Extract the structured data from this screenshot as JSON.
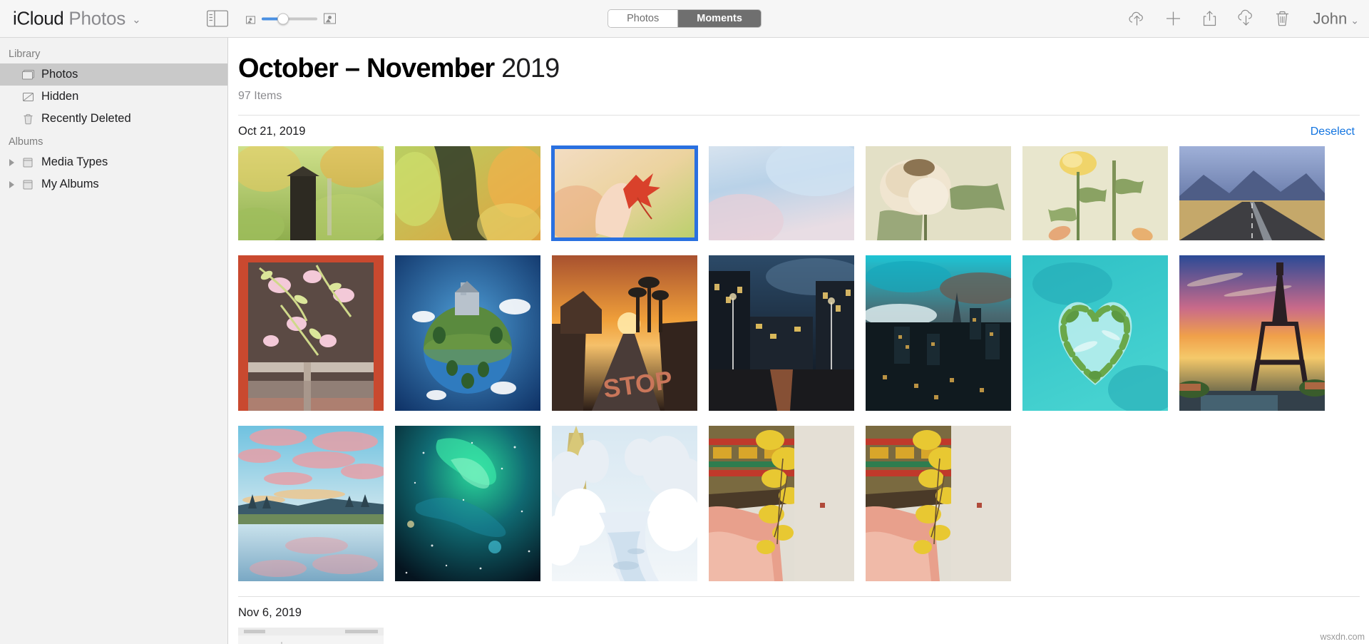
{
  "toolbar": {
    "brand_primary": "iCloud",
    "brand_secondary": "Photos",
    "brand_caret": "⌄",
    "sidebar_toggle_name": "sidebar-toggle",
    "zoom_small_label": "small-thumbnail-icon",
    "zoom_large_label": "large-thumbnail-icon",
    "segments": [
      {
        "label": "Photos",
        "active": false
      },
      {
        "label": "Moments",
        "active": true
      }
    ],
    "actions": [
      {
        "name": "upload-icon",
        "title": "Upload"
      },
      {
        "name": "plus-icon",
        "title": "New Album"
      },
      {
        "name": "share-icon",
        "title": "Share"
      },
      {
        "name": "download-icon",
        "title": "Download"
      },
      {
        "name": "trash-icon",
        "title": "Delete"
      }
    ],
    "account_name": "John",
    "account_caret": "⌄"
  },
  "sidebar": {
    "groups": [
      {
        "title": "Library",
        "items": [
          {
            "label": "Photos",
            "icon": "photos-icon",
            "selected": true,
            "expandable": false
          },
          {
            "label": "Hidden",
            "icon": "hidden-icon",
            "selected": false,
            "expandable": false
          },
          {
            "label": "Recently Deleted",
            "icon": "trash-icon",
            "selected": false,
            "expandable": false
          }
        ]
      },
      {
        "title": "Albums",
        "items": [
          {
            "label": "Media Types",
            "icon": "folder-icon",
            "selected": false,
            "expandable": true
          },
          {
            "label": "My Albums",
            "icon": "folder-icon",
            "selected": false,
            "expandable": true
          }
        ]
      }
    ]
  },
  "main": {
    "title_bold": "October – November",
    "title_light": "2019",
    "item_count": "97 Items",
    "moments": [
      {
        "date": "Oct 21, 2019",
        "action_label": "Deselect",
        "rows": [
          {
            "height": "h132",
            "photos": [
              {
                "alt": "autumn-birdhouse",
                "selected": false
              },
              {
                "alt": "autumn-tree-vines",
                "selected": false
              },
              {
                "alt": "red-maple-leaf-in-hand",
                "selected": true
              },
              {
                "alt": "soft-blue-sky-bokeh",
                "selected": false
              },
              {
                "alt": "dried-white-rose",
                "selected": false
              },
              {
                "alt": "yellow-rose-stem",
                "selected": false
              },
              {
                "alt": "desert-highway",
                "selected": false
              }
            ]
          },
          {
            "height": "h218",
            "photos": [
              {
                "alt": "pink-blossoms-red-wall",
                "selected": false
              },
              {
                "alt": "tiny-planet-castle",
                "selected": false
              },
              {
                "alt": "palm-street-sunset",
                "selected": false
              },
              {
                "alt": "night-city-street",
                "selected": false
              },
              {
                "alt": "city-skyline-dusk",
                "selected": false
              },
              {
                "alt": "heart-shaped-island",
                "selected": false
              },
              {
                "alt": "eiffel-tower-sunset",
                "selected": false
              }
            ]
          },
          {
            "height": "h218",
            "photos": [
              {
                "alt": "lake-reflection-pink-clouds",
                "selected": false
              },
              {
                "alt": "green-aurora-night-sky",
                "selected": false
              },
              {
                "alt": "snowy-winter-forest",
                "selected": false
              },
              {
                "alt": "ginkgo-yellow-leaves-temple",
                "selected": false
              },
              {
                "alt": "ginkgo-yellow-leaves-temple-2",
                "selected": false
              }
            ]
          }
        ]
      },
      {
        "date": "Nov 6, 2019",
        "action_label": "",
        "rows": []
      }
    ]
  },
  "watermark": "wsxdn.com",
  "colors": {
    "accent_blue": "#1274e0",
    "selection_blue": "#2a70e0",
    "slider_blue": "#4a90e2",
    "toolbar_bg": "#f6f6f6",
    "sidebar_bg": "#f2f2f2",
    "sidebar_selected": "#c9c9c9",
    "segment_active_bg": "#6f6f6f"
  }
}
